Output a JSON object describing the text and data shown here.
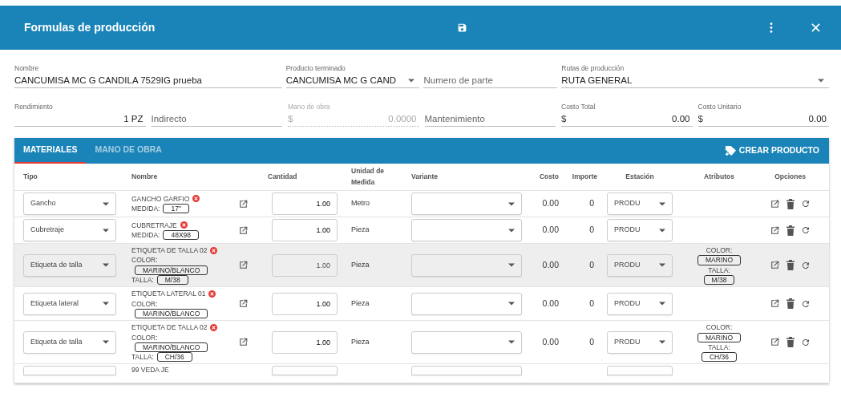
{
  "window": {
    "title": "Formulas de producción"
  },
  "form": [
    [
      {
        "kind": "text",
        "label": "Nombre",
        "value": "CANCUMISA MC G CANDILA 7529IG prueba",
        "disabled": false
      },
      {
        "kind": "select",
        "label": "Producto terminado",
        "value": "CANCUMISA MC G CAND",
        "disabled": false
      },
      {
        "kind": "text",
        "placeholder": "Numero de parte",
        "disabled": false
      },
      {
        "kind": "select",
        "label": "Rutas de producción",
        "value": "RUTA GENERAL",
        "disabled": false
      }
    ],
    [
      {
        "kind": "number",
        "label": "Rendimiento",
        "value": "1 PZ",
        "disabled": false
      },
      {
        "kind": "text",
        "placeholder": "Indirecto",
        "disabled": false
      },
      {
        "kind": "money",
        "label": "Mano de obra",
        "prefix": "$",
        "value": "0.0000",
        "disabled": true
      },
      {
        "kind": "text",
        "placeholder": "Mantenimiento",
        "disabled": false
      },
      {
        "kind": "money",
        "label": "Costo Total",
        "prefix": "$",
        "value": "0.00",
        "disabled": false
      },
      {
        "kind": "money",
        "label": "Costo Unitario",
        "prefix": "$",
        "value": "0.00",
        "disabled": false
      }
    ]
  ],
  "tabs": [
    {
      "label": "MATERIALES",
      "selected": true
    },
    {
      "label": "MANO DE OBRA",
      "selected": false
    }
  ],
  "create_button": {
    "label": "CREAR PRODUCTO"
  },
  "table": {
    "columns": [
      "Tipo",
      "Nombre",
      "Cantidad",
      "Unidad de Medida",
      "Variante",
      "Costo",
      "Importe",
      "Estación",
      "Atributos",
      "Opciones"
    ],
    "rows": [
      {
        "disabled": false,
        "tipo": "Gancho",
        "nombre": "GANCHO GARFIO",
        "specs": [
          {
            "kind": "inline",
            "label": "MEDIDA:",
            "value": "17\""
          }
        ],
        "cantidad": "1.00",
        "unidad": "Metro",
        "costo": "0.00",
        "importe": "0",
        "estacion": "PRODU",
        "atributos": []
      },
      {
        "disabled": false,
        "tipo": "Cubretraje",
        "nombre": "CUBRETRAJE",
        "specs": [
          {
            "kind": "inline",
            "label": "MEDIDA:",
            "value": "48X98"
          }
        ],
        "cantidad": "1.00",
        "unidad": "Pieza",
        "costo": "0.00",
        "importe": "0",
        "estacion": "PRODU",
        "atributos": []
      },
      {
        "disabled": true,
        "tipo": "Etiqueta de talla",
        "nombre": "ETIQUETA DE TALLA 02",
        "specs": [
          {
            "kind": "stacked",
            "label": "COLOR:",
            "value": "MARINO/BLANCO"
          },
          {
            "kind": "inline",
            "label": "TALLA:",
            "value": "M/38"
          }
        ],
        "cantidad": "1.00",
        "unidad": "Pieza",
        "costo": "0.00",
        "importe": "0",
        "estacion": "PRODU",
        "atributos": [
          {
            "label": "COLOR:",
            "value": "MARINO"
          },
          {
            "label": "TALLA:",
            "value": "M/38"
          }
        ]
      },
      {
        "disabled": false,
        "tipo": "Etiqueta lateral",
        "nombre": "ETIQUETA LATERAL 01",
        "specs": [
          {
            "kind": "stacked",
            "label": "COLOR:",
            "value": "MARINO/BLANCO"
          }
        ],
        "cantidad": "1.00",
        "unidad": "Pieza",
        "costo": "0.00",
        "importe": "0",
        "estacion": "PRODU",
        "atributos": []
      },
      {
        "disabled": false,
        "tipo": "Etiqueta de talla",
        "nombre": "ETIQUETA DE TALLA 02",
        "specs": [
          {
            "kind": "stacked",
            "label": "COLOR:",
            "value": "MARINO/BLANCO"
          },
          {
            "kind": "inline",
            "label": "TALLA:",
            "value": "CH/36"
          }
        ],
        "cantidad": "1.00",
        "unidad": "Pieza",
        "costo": "0.00",
        "importe": "0",
        "estacion": "PRODU",
        "atributos": [
          {
            "label": "COLOR:",
            "value": "MARINO"
          },
          {
            "label": "TALLA:",
            "value": "CH/36"
          }
        ]
      },
      {
        "disabled": false,
        "nombre": "99 VEDA JE",
        "specs": [],
        "atributos": []
      }
    ]
  }
}
